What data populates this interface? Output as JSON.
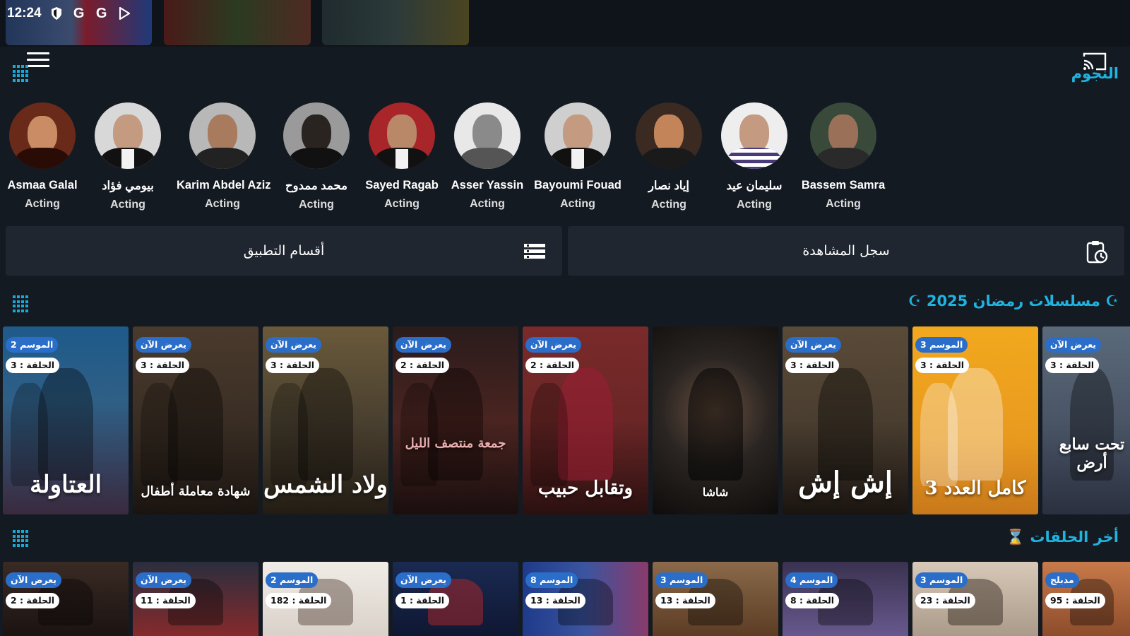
{
  "status_bar": {
    "time": "12:24",
    "icons": [
      "shield-icon",
      "google-icon",
      "google-icon",
      "play-store-icon"
    ]
  },
  "stars_section": {
    "title": "النجوم",
    "stars": [
      {
        "name": "Asmaa Galal",
        "role": "Acting"
      },
      {
        "name": "بيومي فؤاد",
        "role": "Acting"
      },
      {
        "name": "Karim Abdel Aziz",
        "role": "Acting"
      },
      {
        "name": "محمد ممدوح",
        "role": "Acting"
      },
      {
        "name": "Sayed Ragab",
        "role": "Acting"
      },
      {
        "name": "Asser Yassin",
        "role": "Acting"
      },
      {
        "name": "Bayoumi Fouad",
        "role": "Acting"
      },
      {
        "name": "إياد نصار",
        "role": "Acting"
      },
      {
        "name": "سليمان عيد",
        "role": "Acting"
      },
      {
        "name": "Bassem Samra",
        "role": "Acting"
      }
    ]
  },
  "actions": {
    "categories_label": "أقسام التطبيق",
    "history_label": "سجل المشاهدة"
  },
  "ramadan_section": {
    "title": "مسلسلات رمضان 2025",
    "items": [
      {
        "badge": "الموسم 2",
        "episode": "الحلقة : 3",
        "title": "العتاولة",
        "color": "#2f5f86"
      },
      {
        "badge": "يعرض الآن",
        "episode": "الحلقة : 3",
        "title": "شهادة معاملة أطفال",
        "color": "#4a3a2c"
      },
      {
        "badge": "يعرض الآن",
        "episode": "الحلقة : 3",
        "title": "ولاد الشمس",
        "color": "#5a5036"
      },
      {
        "badge": "يعرض الآن",
        "episode": "الحلقة : 2",
        "title": "جمعة منتصف الليل",
        "color": "#3a2422"
      },
      {
        "badge": "يعرض الآن",
        "episode": "الحلقة : 2",
        "title": "وتقابل حبيب",
        "color": "#6b2626"
      },
      {
        "badge": "",
        "episode": "",
        "title": "شاشا",
        "color": "#2a2522"
      },
      {
        "badge": "يعرض الآن",
        "episode": "الحلقة : 3",
        "title": "إش إش",
        "color": "#4a3e30"
      },
      {
        "badge": "الموسم 3",
        "episode": "الحلقة : 3",
        "title": "كامل العدد 3",
        "color": "#e89a1f"
      },
      {
        "badge": "يعرض الآن",
        "episode": "الحلقة : 3",
        "title": "تحت سابع أرض",
        "color": "#4a5566"
      }
    ]
  },
  "latest_section": {
    "title": "أخر الحلقات",
    "items": [
      {
        "badge": "يعرض الآن",
        "episode": "الحلقة : 2",
        "color": "#3a2a24"
      },
      {
        "badge": "يعرض الآن",
        "episode": "الحلقة : 11",
        "color": "#2a2e3e"
      },
      {
        "badge": "الموسم 2",
        "episode": "الحلقة : 182",
        "color": "#e8e4df"
      },
      {
        "badge": "يعرض الآن",
        "episode": "الحلقة : 1",
        "color": "#1b2a52"
      },
      {
        "badge": "الموسم 8",
        "episode": "الحلقة : 13",
        "color": "#3b55a0"
      },
      {
        "badge": "الموسم 3",
        "episode": "الحلقة : 13",
        "color": "#7a5a3a"
      },
      {
        "badge": "الموسم 4",
        "episode": "الحلقة : 8",
        "color": "#3a3250"
      },
      {
        "badge": "الموسم 3",
        "episode": "الحلقة : 23",
        "color": "#c8b8a8"
      },
      {
        "badge": "مدبلج",
        "episode": "الحلقة : 95",
        "color": "#b36a3a"
      }
    ]
  },
  "colors": {
    "accent": "#1fb3df",
    "background": "#141a22",
    "card": "#1f2630",
    "badge_blue": "#2a6ec9"
  }
}
